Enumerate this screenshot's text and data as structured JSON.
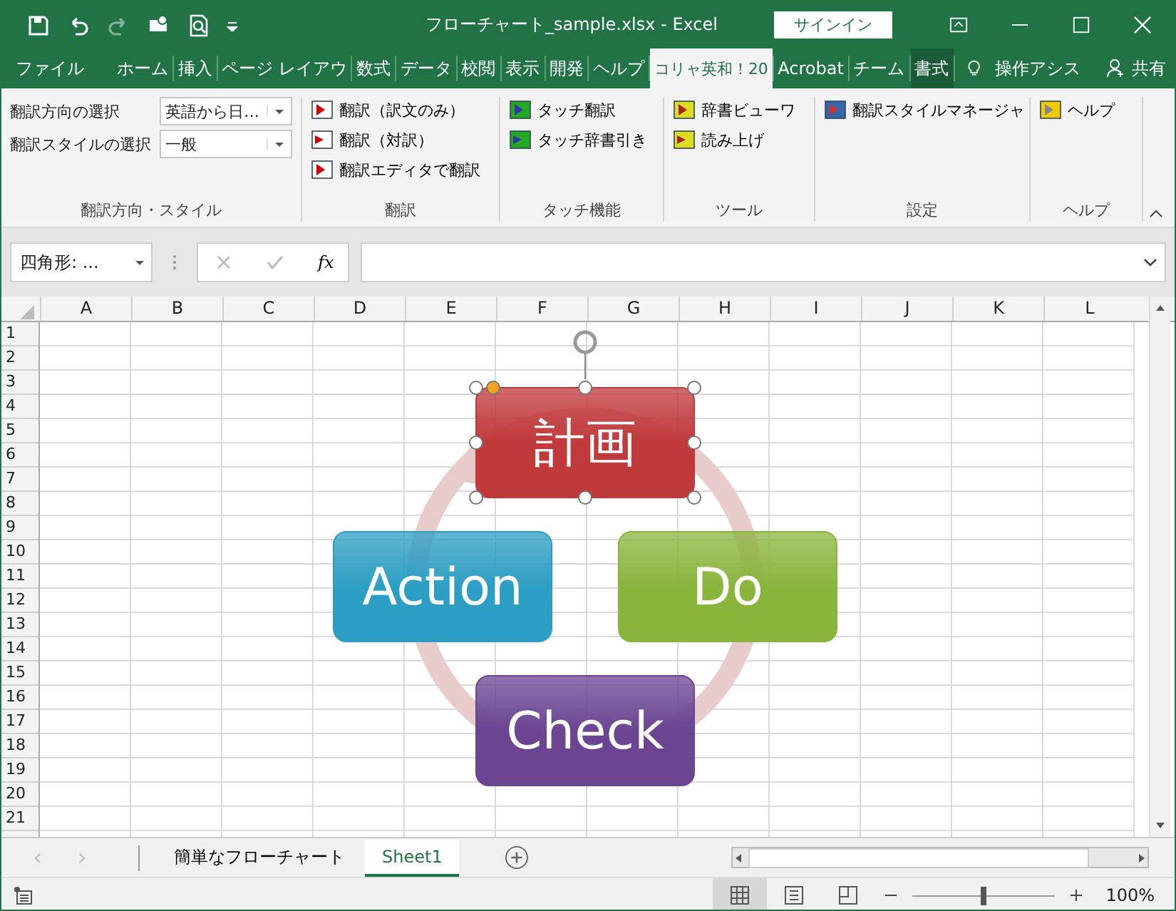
{
  "window": {
    "title": "フローチャート_sample.xlsx  -  Excel",
    "signin": "サインイン"
  },
  "ribbon_tabs": [
    {
      "label": "ファイル",
      "selected": false,
      "kind": "plain"
    },
    {
      "label": "ホーム",
      "selected": false,
      "kind": "plain"
    },
    {
      "label": "挿入",
      "selected": false,
      "kind": "plain"
    },
    {
      "label": "ページ レイアウ",
      "selected": false,
      "kind": "plain"
    },
    {
      "label": "数式",
      "selected": false,
      "kind": "plain"
    },
    {
      "label": "データ",
      "selected": false,
      "kind": "plain"
    },
    {
      "label": "校閲",
      "selected": false,
      "kind": "plain"
    },
    {
      "label": "表示",
      "selected": false,
      "kind": "plain"
    },
    {
      "label": "開発",
      "selected": false,
      "kind": "plain"
    },
    {
      "label": "ヘルプ",
      "selected": false,
      "kind": "plain"
    },
    {
      "label": "コリャ英和！20",
      "selected": true,
      "kind": "plain"
    },
    {
      "label": "Acrobat",
      "selected": false,
      "kind": "plain"
    },
    {
      "label": "チーム",
      "selected": false,
      "kind": "plain"
    },
    {
      "label": "書式",
      "selected": false,
      "kind": "contextual"
    }
  ],
  "tell_me": "操作アシス",
  "share": "共有",
  "ribbon_groups": [
    {
      "title": "翻訳方向・スタイル",
      "items": [
        {
          "kind": "combo",
          "label": "翻訳方向の選択",
          "value": "英語から日…"
        },
        {
          "kind": "combo",
          "label": "翻訳スタイルの選択",
          "value": "一般"
        }
      ]
    },
    {
      "title": "翻訳",
      "items": [
        {
          "kind": "button",
          "label": "翻訳（訳文のみ）"
        },
        {
          "kind": "button",
          "label": "翻訳（対訳）"
        },
        {
          "kind": "button",
          "label": "翻訳エディタで翻訳"
        }
      ]
    },
    {
      "title": "タッチ機能",
      "items": [
        {
          "kind": "button",
          "label": "タッチ翻訳"
        },
        {
          "kind": "button",
          "label": "タッチ辞書引き"
        }
      ]
    },
    {
      "title": "ツール",
      "items": [
        {
          "kind": "button",
          "label": "辞書ビューワ"
        },
        {
          "kind": "button",
          "label": "読み上げ"
        }
      ]
    },
    {
      "title": "設定",
      "items": [
        {
          "kind": "button",
          "label": "翻訳スタイルマネージャ"
        }
      ]
    },
    {
      "title": "ヘルプ",
      "items": [
        {
          "kind": "button",
          "label": "ヘルプ"
        }
      ]
    }
  ],
  "formula_bar": {
    "name_box": "四角形: ...",
    "function_button": "fx"
  },
  "columns": [
    "A",
    "B",
    "C",
    "D",
    "E",
    "F",
    "G",
    "H",
    "I",
    "J",
    "K",
    "L"
  ],
  "rows": [
    "1",
    "2",
    "3",
    "4",
    "5",
    "6",
    "7",
    "8",
    "9",
    "10",
    "11",
    "12",
    "13",
    "14",
    "15",
    "16",
    "17",
    "18",
    "19",
    "20",
    "21"
  ],
  "diagram": {
    "shapes": [
      {
        "text": "計画",
        "color": "#c0393b",
        "selected": true
      },
      {
        "text": "Do",
        "color": "#8ab53d",
        "selected": false
      },
      {
        "text": "Check",
        "color": "#6b4592",
        "selected": false
      },
      {
        "text": "Action",
        "color": "#2d9ec3",
        "selected": false
      }
    ]
  },
  "sheet_tabs": [
    {
      "label": "簡単なフローチャート",
      "selected": false
    },
    {
      "label": "Sheet1",
      "selected": true
    }
  ],
  "status_bar": {
    "views": [
      {
        "selected": true
      },
      {
        "selected": false
      },
      {
        "selected": false
      }
    ],
    "zoom": {
      "level": 0.5
    },
    "zoom_text": "100%"
  }
}
